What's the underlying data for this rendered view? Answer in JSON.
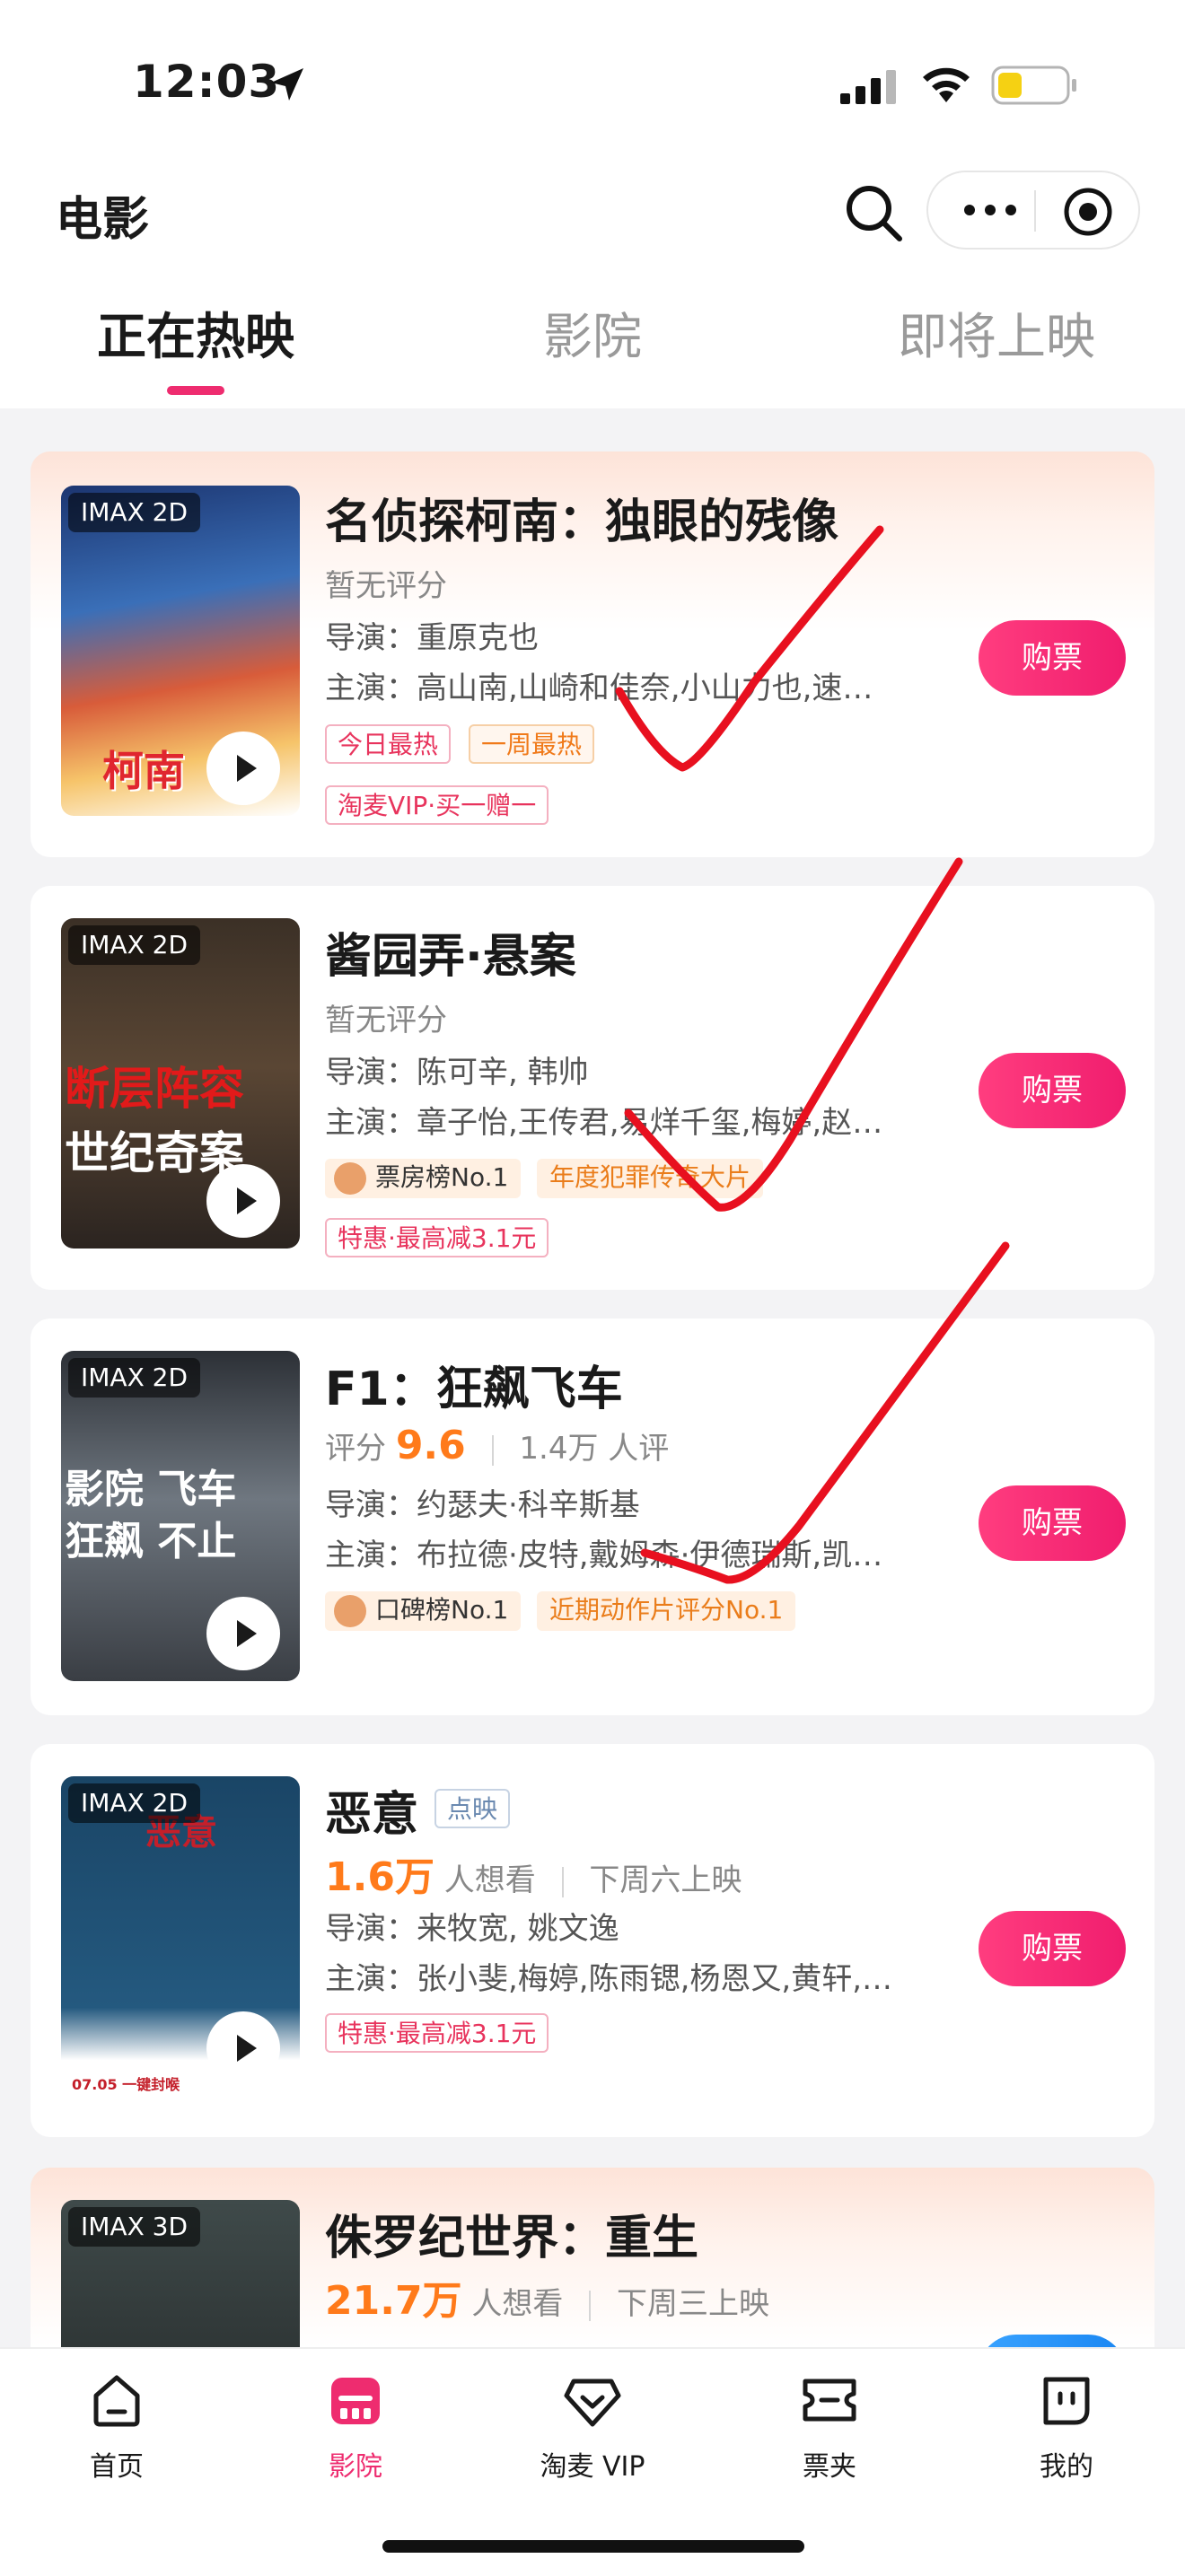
{
  "status_bar": {
    "time": "12:03"
  },
  "header": {
    "title": "电影"
  },
  "tabs": [
    {
      "label": "正在热映"
    },
    {
      "label": "影院"
    },
    {
      "label": "即将上映"
    }
  ],
  "movies": [
    {
      "badge": "IMAX 2D",
      "title": "名侦探柯南：独眼的残像",
      "rating_text": "暂无评分",
      "director": "导演：重原克也",
      "cast": "主演：高山南,山崎和佳奈,小山力也,速…",
      "tags": [
        "今日最热",
        "一周最热"
      ],
      "promo": "淘麦VIP·买一赠一",
      "buy_label": "购票",
      "poster_text": "柯南"
    },
    {
      "badge": "IMAX 2D",
      "title": "酱园弄·悬案",
      "rating_text": "暂无评分",
      "director": "导演：陈可辛, 韩帅",
      "cast": "主演：章子怡,王传君,易烊千玺,梅婷,赵…",
      "rank_tag": "票房榜No.1",
      "tag2": "年度犯罪传奇大片",
      "promo": "特惠·最高减3.1元",
      "buy_label": "购票",
      "poster_text_1": "断层阵容",
      "poster_text_2": "世纪奇案"
    },
    {
      "badge": "IMAX 2D",
      "title": "F1：狂飙飞车",
      "score_label": "评分",
      "score": "9.6",
      "review_count": "1.4万 人评",
      "director": "导演：约瑟夫·科辛斯基",
      "cast": "主演：布拉德·皮特,戴姆森·伊德瑞斯,凯…",
      "rank_tag": "口碑榜No.1",
      "tag2": "近期动作片评分No.1",
      "buy_label": "购票",
      "poster_text_1": "影院 飞车",
      "poster_text_2": "狂飙 不止"
    },
    {
      "badge": "IMAX 2D",
      "title": "恶意",
      "pre_tag": "点映",
      "want_count": "1.6万",
      "want_label": "人想看",
      "release": "下周六上映",
      "director": "导演：来牧宽, 姚文逸",
      "cast": "主演：张小斐,梅婷,陈雨锶,杨恩又,黄轩,…",
      "promo": "特惠·最高减3.1元",
      "buy_label": "购票",
      "poster_text": "恶意",
      "poster_date": "07.05 一键封喉"
    },
    {
      "badge": "IMAX 3D",
      "title": "侏罗纪世界：重生",
      "want_count": "21.7万",
      "want_label": "人想看",
      "release": "下周三上映"
    }
  ],
  "bottom_nav": [
    {
      "label": "首页"
    },
    {
      "label": "影院"
    },
    {
      "label": "淘麦 VIP"
    },
    {
      "label": "票夹"
    },
    {
      "label": "我的"
    }
  ],
  "colors": {
    "accent": "#ee2c6f",
    "score": "#ff7a1a",
    "annotation": "#e8101f"
  }
}
